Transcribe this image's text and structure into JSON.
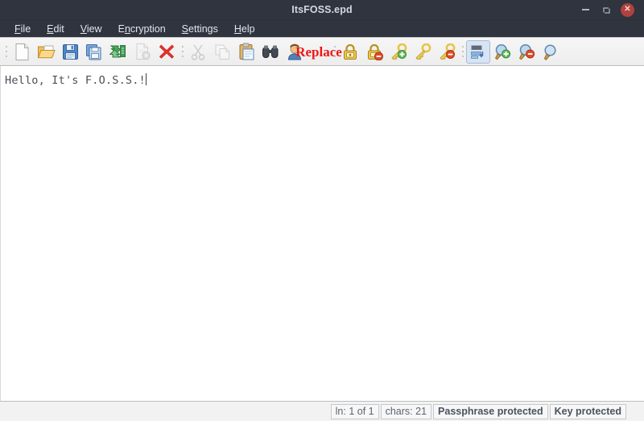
{
  "window": {
    "title": "ItsFOSS.epd",
    "controls": [
      {
        "name": "minimize",
        "label": "–"
      },
      {
        "name": "maximize",
        "label": ""
      },
      {
        "name": "close",
        "label": "✕"
      }
    ]
  },
  "menubar": {
    "items": [
      {
        "name": "file",
        "pre": "",
        "mnemonic": "F",
        "post": "ile"
      },
      {
        "name": "edit",
        "pre": "",
        "mnemonic": "E",
        "post": "dit"
      },
      {
        "name": "view",
        "pre": "",
        "mnemonic": "V",
        "post": "iew"
      },
      {
        "name": "encryption",
        "pre": "E",
        "mnemonic": "n",
        "post": "cryption"
      },
      {
        "name": "settings",
        "pre": "",
        "mnemonic": "S",
        "post": "ettings"
      },
      {
        "name": "help",
        "pre": "",
        "mnemonic": "H",
        "post": "elp"
      }
    ]
  },
  "toolbar": {
    "groups": [
      {
        "name": "file-group",
        "buttons": [
          {
            "name": "new-file-icon",
            "icon": "new-file",
            "label": "New",
            "disabled": false,
            "active": false
          },
          {
            "name": "open-folder-icon",
            "icon": "open-folder",
            "label": "Open",
            "disabled": false,
            "active": false
          },
          {
            "name": "save-icon",
            "icon": "save",
            "label": "Save",
            "disabled": false,
            "active": false
          },
          {
            "name": "save-as-icon",
            "icon": "save-as",
            "label": "Save As",
            "disabled": false,
            "active": false
          },
          {
            "name": "save-all-icon",
            "icon": "save-all",
            "label": "Save All",
            "disabled": false,
            "active": false
          },
          {
            "name": "print-preview-icon",
            "icon": "doc-gear",
            "label": "Print Preview",
            "disabled": true,
            "active": false
          },
          {
            "name": "close-file-icon",
            "icon": "red-x",
            "label": "Close",
            "disabled": false,
            "active": false
          }
        ]
      },
      {
        "name": "edit-group",
        "buttons": [
          {
            "name": "cut-icon",
            "icon": "scissors",
            "label": "Cut",
            "disabled": true,
            "active": false
          },
          {
            "name": "copy-icon",
            "icon": "copy",
            "label": "Copy",
            "disabled": true,
            "active": false
          },
          {
            "name": "paste-icon",
            "icon": "clipboard",
            "label": "Paste",
            "disabled": false,
            "active": false
          },
          {
            "name": "find-icon",
            "icon": "binoculars",
            "label": "Find",
            "disabled": false,
            "active": false
          },
          {
            "name": "goto-person-icon",
            "icon": "person",
            "label": "Go To",
            "disabled": false,
            "active": false
          },
          {
            "name": "replace-icon",
            "icon": "letter-r",
            "label": "Replace",
            "disabled": false,
            "active": false
          }
        ]
      },
      {
        "name": "encryption-group",
        "buttons": [
          {
            "name": "lock-icon",
            "icon": "padlock",
            "label": "Set Passphrase",
            "disabled": false,
            "active": false
          },
          {
            "name": "unlock-icon",
            "icon": "padlock-minus",
            "label": "Remove Passphrase",
            "disabled": false,
            "active": false
          },
          {
            "name": "key-add-icon",
            "icon": "key-plus",
            "label": "Add Key",
            "disabled": false,
            "active": false
          },
          {
            "name": "key-icon",
            "icon": "key",
            "label": "Key",
            "disabled": false,
            "active": false
          },
          {
            "name": "key-remove-icon",
            "icon": "key-minus",
            "label": "Remove Key",
            "disabled": false,
            "active": false
          }
        ]
      },
      {
        "name": "view-group",
        "buttons": [
          {
            "name": "word-wrap-icon",
            "icon": "word-wrap",
            "label": "Word Wrap",
            "disabled": false,
            "active": true
          },
          {
            "name": "zoom-in-icon",
            "icon": "zoom-in",
            "label": "Zoom In",
            "disabled": false,
            "active": false
          },
          {
            "name": "zoom-out-icon",
            "icon": "zoom-out",
            "label": "Zoom Out",
            "disabled": false,
            "active": false
          },
          {
            "name": "zoom-reset-icon",
            "icon": "zoom-reset",
            "label": "Zoom Reset",
            "disabled": false,
            "active": false
          }
        ]
      }
    ]
  },
  "editor": {
    "content": "Hello, It's F.O.S.S.!"
  },
  "statusbar": {
    "items": [
      {
        "name": "line-indicator",
        "text": "ln: 1 of 1",
        "bold": false
      },
      {
        "name": "char-count",
        "text": "chars: 21",
        "bold": false
      },
      {
        "name": "passphrase-badge",
        "text": "Passphrase protected",
        "bold": true
      },
      {
        "name": "key-badge",
        "text": "Key protected",
        "bold": true
      }
    ]
  },
  "colors": {
    "titlebar_bg": "#2f343f",
    "titlebar_text": "#d3d8e0",
    "toolbar_bg": "#f1f1f1",
    "editor_bg": "#ffffff",
    "editor_text": "#4a4f58",
    "statusbar_bg": "#f2f2f2",
    "close_button": "#b0413e",
    "active_toggle": "#d7e4f4"
  }
}
